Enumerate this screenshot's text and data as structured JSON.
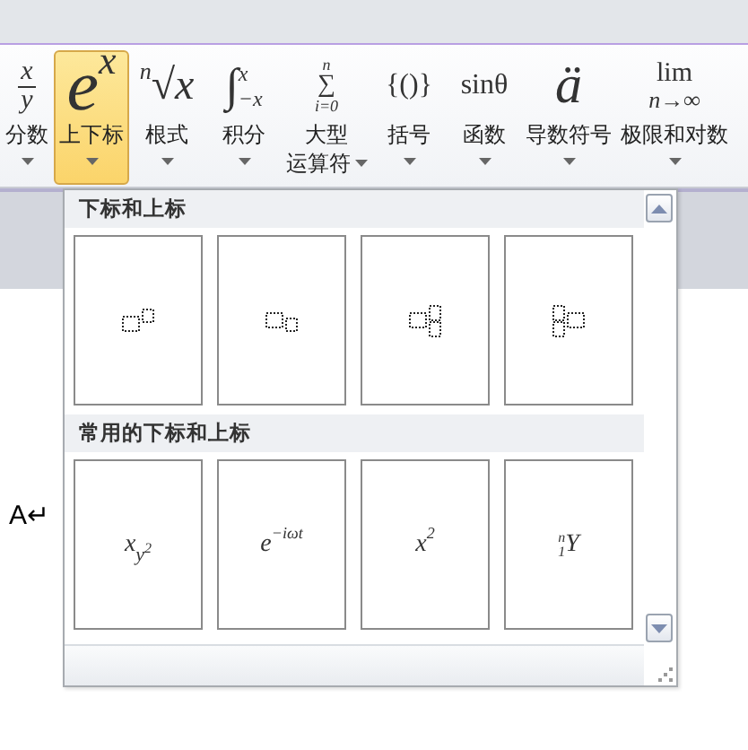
{
  "ribbon": {
    "buttons": [
      {
        "kind": "fraction",
        "top": "x",
        "bottom": "y",
        "label": [
          "分数"
        ],
        "selected": false
      },
      {
        "kind": "script",
        "main": "e",
        "sup": "x",
        "label": [
          "上下标"
        ],
        "selected": true
      },
      {
        "kind": "script",
        "pre": "n",
        "main": "√x",
        "label": [
          "根式"
        ],
        "selected": false
      },
      {
        "kind": "limits",
        "main": "∫",
        "sup": "x",
        "sub": "−x",
        "label": [
          "积分"
        ],
        "selected": false
      },
      {
        "kind": "stacked",
        "top": "n",
        "main": "∑",
        "bottom": "i=0",
        "label": [
          "大型",
          "运算符"
        ],
        "selected": false
      },
      {
        "kind": "plain",
        "main": "{()}",
        "label": [
          "括号"
        ],
        "selected": false
      },
      {
        "kind": "plain",
        "main": "sinθ",
        "label": [
          "函数"
        ],
        "selected": false
      },
      {
        "kind": "plain",
        "main": "ä",
        "label": [
          "导数符号"
        ],
        "selected": false
      },
      {
        "kind": "stacked",
        "main": "lim",
        "bottom": "n→∞",
        "label": [
          "极限和对数"
        ],
        "selected": false
      }
    ]
  },
  "gallery": {
    "sections": [
      {
        "title": "下标和上标",
        "items": [
          {
            "kind": "sup"
          },
          {
            "kind": "sub"
          },
          {
            "kind": "subsup"
          },
          {
            "kind": "presubsup"
          }
        ]
      },
      {
        "title": "常用的下标和上标",
        "items": [
          {
            "kind": "formula",
            "base": "x",
            "sub": "y",
            "sub_sup": "2"
          },
          {
            "kind": "formula",
            "base": "e",
            "sup": "−iωt"
          },
          {
            "kind": "formula",
            "base": "x",
            "sup": "2"
          },
          {
            "kind": "formula",
            "base": "Y",
            "pre_sup": "n",
            "pre_sub": "1"
          }
        ]
      }
    ]
  },
  "document": {
    "text": "A↵"
  }
}
